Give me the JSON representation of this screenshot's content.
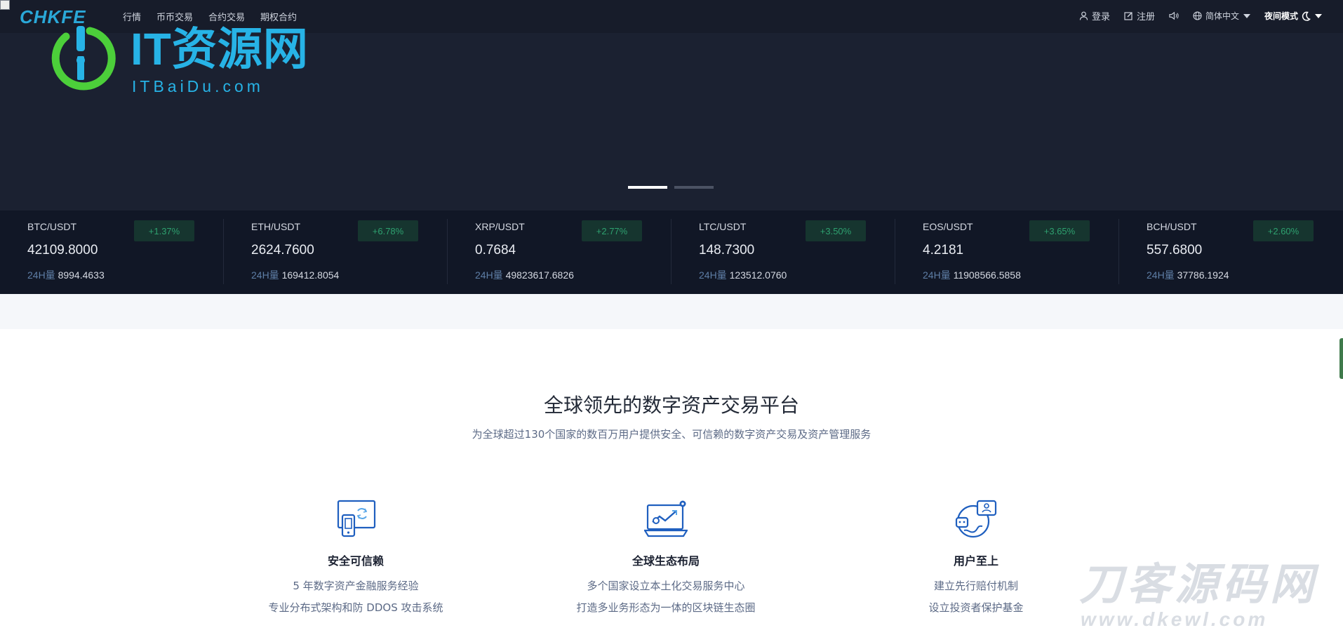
{
  "header": {
    "brand": "CHKFE",
    "nav": [
      "行情",
      "币币交易",
      "合约交易",
      "期权合约"
    ],
    "login": "登录",
    "register": "注册",
    "language": "简体中文",
    "night_mode": "夜间模式"
  },
  "banner_watermark": {
    "title": "IT资源网",
    "subtitle": "ITBaiDu.com"
  },
  "carousel": {
    "slides": 2,
    "active": 0
  },
  "ticker": [
    {
      "pair": "BTC/USDT",
      "change": "+1.37%",
      "price": "42109.8000",
      "vol_label": "24H量",
      "volume": "8994.4633"
    },
    {
      "pair": "ETH/USDT",
      "change": "+6.78%",
      "price": "2624.7600",
      "vol_label": "24H量",
      "volume": "169412.8054"
    },
    {
      "pair": "XRP/USDT",
      "change": "+2.77%",
      "price": "0.7684",
      "vol_label": "24H量",
      "volume": "49823617.6826"
    },
    {
      "pair": "LTC/USDT",
      "change": "+3.50%",
      "price": "148.7300",
      "vol_label": "24H量",
      "volume": "123512.0760"
    },
    {
      "pair": "EOS/USDT",
      "change": "+3.65%",
      "price": "4.2181",
      "vol_label": "24H量",
      "volume": "11908566.5858"
    },
    {
      "pair": "BCH/USDT",
      "change": "+2.60%",
      "price": "557.6800",
      "vol_label": "24H量",
      "volume": "37786.1924"
    }
  ],
  "intro": {
    "title": "全球领先的数字资产交易平台",
    "subtitle": "为全球超过130个国家的数百万用户提供安全、可信赖的数字资产交易及资产管理服务"
  },
  "features": [
    {
      "icon": "secure-device-icon",
      "title": "安全可信赖",
      "lines": [
        "5 年数字资产金融服务经验",
        "专业分布式架构和防 DDOS 攻击系统"
      ]
    },
    {
      "icon": "global-chart-icon",
      "title": "全球生态布局",
      "lines": [
        "多个国家设立本土化交易服务中心",
        "打造多业务形态为一体的区块链生态圈"
      ]
    },
    {
      "icon": "user-support-icon",
      "title": "用户至上",
      "lines": [
        "建立先行赔付机制",
        "设立投资者保护基金"
      ]
    }
  ],
  "footer_watermark": {
    "title": "刀客源码网",
    "subtitle": "www.dkewl.com"
  },
  "colors": {
    "header_bg": "#171c2a",
    "hero_bg": "#1b2131",
    "ticker_bg": "#111726",
    "up_green": "#2ea06f",
    "accent_blue": "#1f5fbf"
  }
}
